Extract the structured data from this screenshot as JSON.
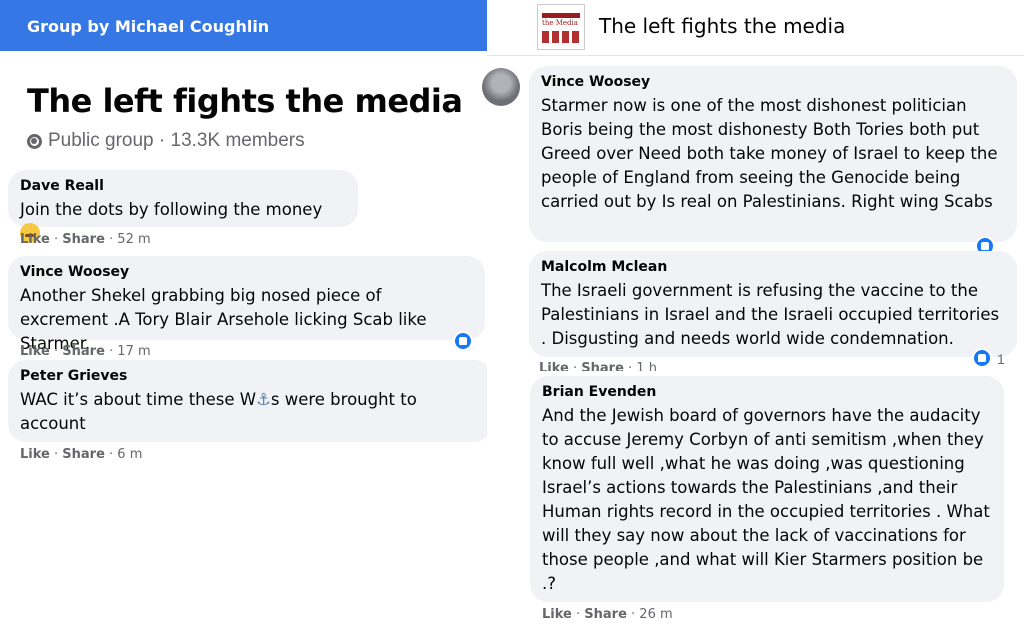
{
  "left": {
    "topbar": "Group by Michael Coughlin",
    "group_title": "The left fights the media",
    "group_meta": "Public group · 13.3K members",
    "comments": [
      {
        "author": "Dave Reall",
        "text": "Join the dots by following the money",
        "like": "Like",
        "share": "Share",
        "time": "52 m"
      },
      {
        "author": "Vince Woosey",
        "text": "Another Shekel grabbing big nosed piece of excrement .A Tory Blair Arsehole licking Scab like Starmer.",
        "like": "Like",
        "share": "Share",
        "time": "17 m"
      },
      {
        "author": "Peter Grieves",
        "text_before": "WAC it’s about time these W",
        "anchor": "⚓",
        "text_after": "s were brought to account",
        "like": "Like",
        "share": "Share",
        "time": "6 m"
      }
    ]
  },
  "right": {
    "header_title": "The left fights the media",
    "thumb_text": "the Media",
    "comments": [
      {
        "author": "Vince Woosey",
        "text": "Starmer now is one of the most dishonest politician Boris being the most dishonesty Both Tories both put Greed over Need both take money of Israel to keep the people of England from seeing the Genocide being carried out by Is real on Palestinians. Right wing Scabs"
      },
      {
        "author": "Malcolm Mclean",
        "text": "The Israeli government is refusing the vaccine to the Palestinians in Israel and the Israeli occupied territories . Disgusting and needs world wide condemnation.",
        "like": "Like",
        "share": "Share",
        "time": "1 h",
        "reactions": "1"
      },
      {
        "author": "Brian Evenden",
        "text": "And the Jewish board of governors have the audacity to accuse Jeremy Corbyn of anti semitism ,when they know full well ,what he was doing ,was questioning Israel’s actions towards the Palestinians ,and their Human rights record in the occupied territories . What will they say now about the lack of vaccinations for those people ,and what will Kier Starmers position be .?",
        "like": "Like",
        "share": "Share",
        "time": "26 m"
      }
    ]
  },
  "colors": {
    "accent": "#3578e5",
    "bubble": "#f0f2f5",
    "meta": "#65676b",
    "like_blue": "#1877f2"
  }
}
